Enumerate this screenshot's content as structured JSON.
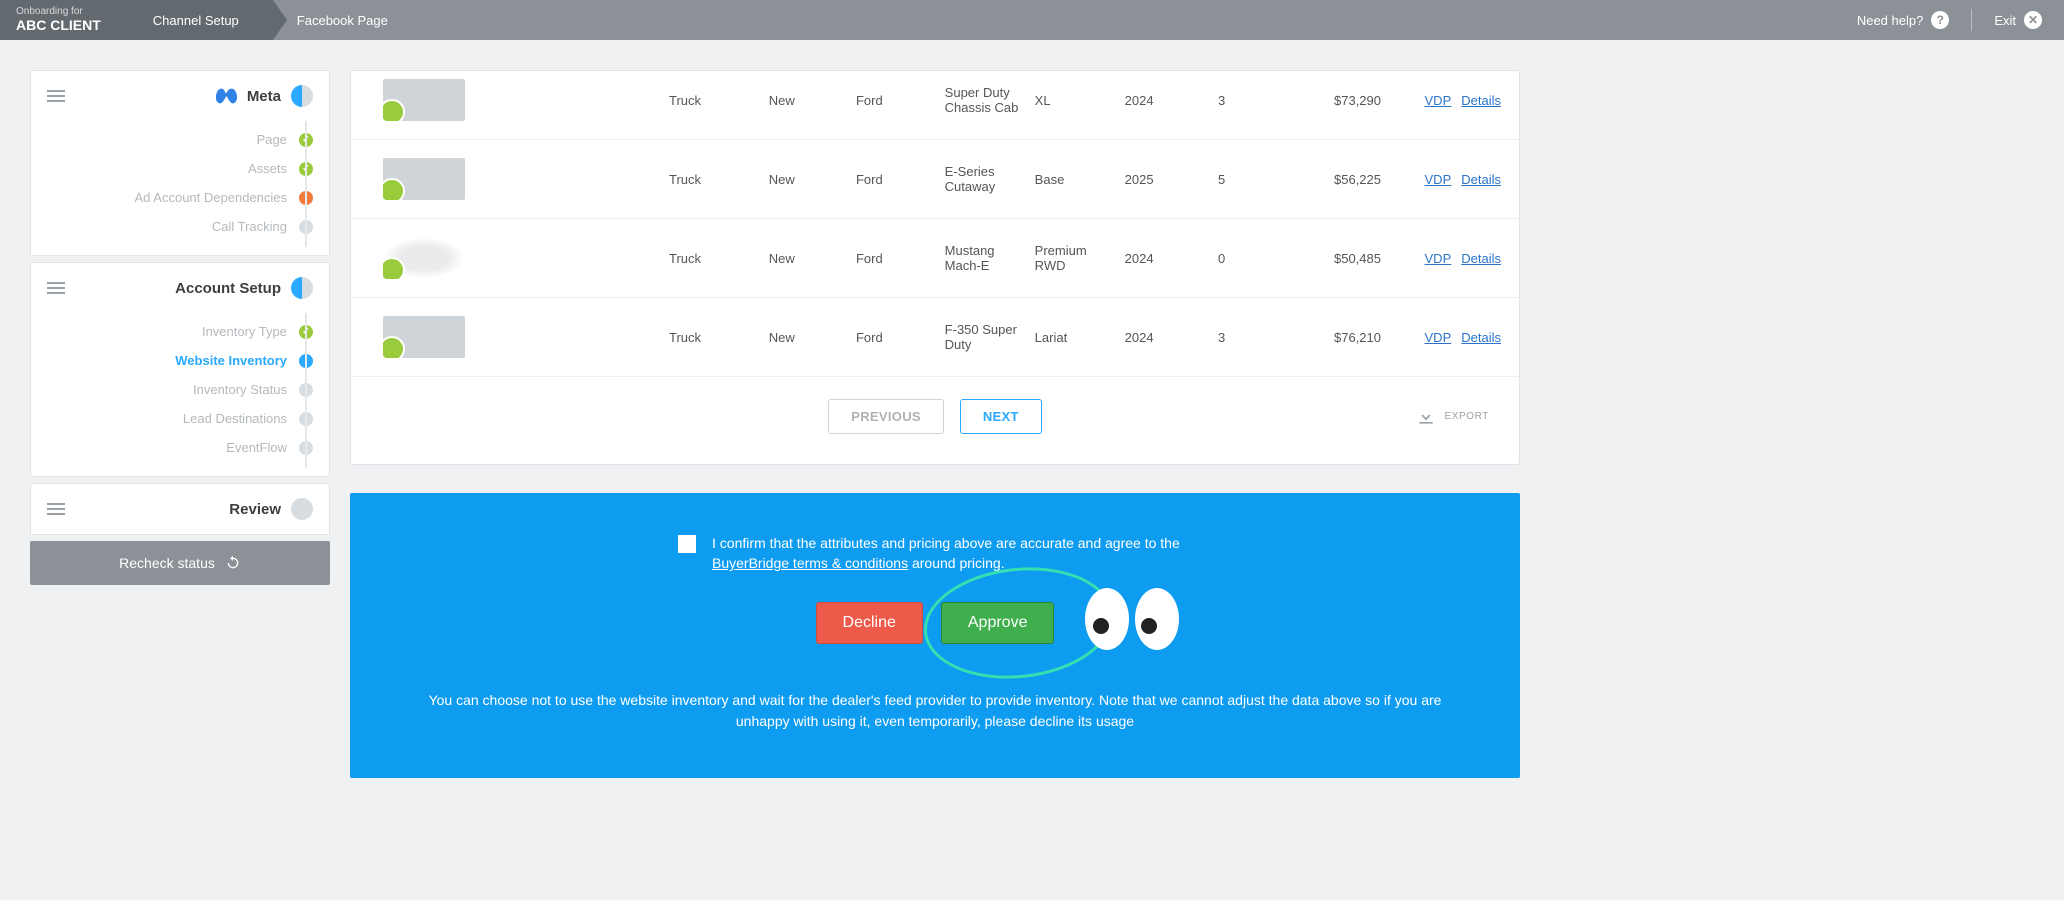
{
  "topbar": {
    "onboarding_small": "Onboarding for",
    "client": "ABC CLIENT",
    "crumbs": [
      "Channel Setup",
      "Facebook Page"
    ],
    "help": "Need help?",
    "exit": "Exit"
  },
  "sidebar": {
    "meta": {
      "title": "Meta",
      "steps": [
        {
          "label": "Page",
          "state": "ok"
        },
        {
          "label": "Assets",
          "state": "ok"
        },
        {
          "label": "Ad Account Dependencies",
          "state": "warn"
        },
        {
          "label": "Call Tracking",
          "state": "grey"
        }
      ]
    },
    "account": {
      "title": "Account Setup",
      "steps": [
        {
          "label": "Inventory Type",
          "state": "ok"
        },
        {
          "label": "Website Inventory",
          "state": "active"
        },
        {
          "label": "Inventory Status",
          "state": "grey"
        },
        {
          "label": "Lead Destinations",
          "state": "grey"
        },
        {
          "label": "EventFlow",
          "state": "grey"
        }
      ]
    },
    "review": {
      "title": "Review"
    },
    "recheck": "Recheck status"
  },
  "table": {
    "rows": [
      {
        "body": "Truck",
        "cond": "New",
        "make": "Ford",
        "model": "Super Duty Chassis Cab",
        "trim": "XL",
        "year": "2024",
        "img": "3",
        "price": "$73,290"
      },
      {
        "body": "Truck",
        "cond": "New",
        "make": "Ford",
        "model": "E-Series Cutaway",
        "trim": "Base",
        "year": "2025",
        "img": "5",
        "price": "$56,225"
      },
      {
        "body": "Truck",
        "cond": "New",
        "make": "Ford",
        "model": "Mustang Mach-E",
        "trim": "Premium RWD",
        "year": "2024",
        "img": "0",
        "price": "$50,485",
        "noimg": true
      },
      {
        "body": "Truck",
        "cond": "New",
        "make": "Ford",
        "model": "F-350 Super Duty",
        "trim": "Lariat",
        "year": "2024",
        "img": "3",
        "price": "$76,210"
      }
    ],
    "vdp": "VDP",
    "details": "Details",
    "previous": "PREVIOUS",
    "next": "NEXT",
    "export": "EXPORT"
  },
  "confirm": {
    "text1": "I confirm that the attributes and pricing above are accurate and agree to the ",
    "terms": "BuyerBridge terms & conditions",
    "text2": " around pricing.",
    "decline": "Decline",
    "approve": "Approve",
    "note": "You can choose not to use the website inventory and wait for the dealer's feed provider to provide inventory. Note that we cannot adjust the data above so if you are unhappy with using it, even temporarily, please decline its usage"
  }
}
